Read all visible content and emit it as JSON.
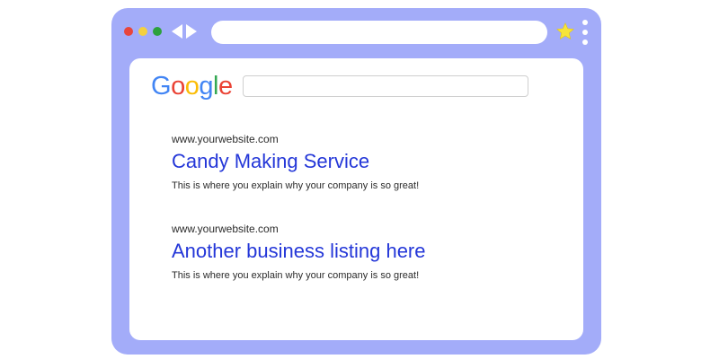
{
  "browser": {
    "frame_color": "#a3acf9",
    "window_controls": [
      "close",
      "minimize",
      "maximize"
    ],
    "nav": [
      "back-arrow-icon",
      "forward-arrow-icon"
    ],
    "address_bar_value": "",
    "bookmark_icon": "star-icon",
    "menu_icon": "kebab-menu-icon"
  },
  "page": {
    "logo": {
      "letters": [
        "G",
        "o",
        "o",
        "g",
        "l",
        "e"
      ]
    },
    "search": {
      "value": ""
    },
    "results": [
      {
        "url": "www.yourwebsite.com",
        "title": "Candy Making Service",
        "description": "This is where you explain why your company is so great!"
      },
      {
        "url": "www.yourwebsite.com",
        "title": "Another business listing here",
        "description": "This is where you explain why your company is so great!"
      }
    ]
  }
}
